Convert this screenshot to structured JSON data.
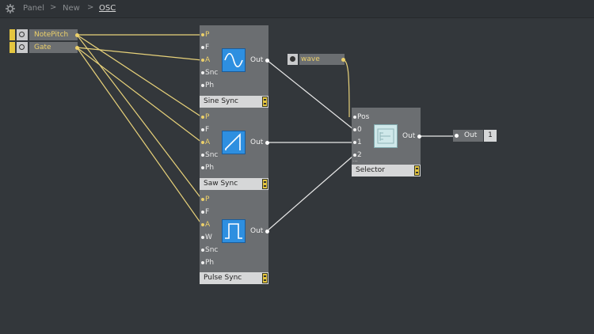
{
  "breadcrumb": {
    "items": [
      "Panel",
      "New",
      "OSC"
    ],
    "separator": ">"
  },
  "sources": [
    {
      "label": "NotePitch"
    },
    {
      "label": "Gate"
    }
  ],
  "oscillators": [
    {
      "name": "Sine Sync",
      "ports": [
        "P",
        "F",
        "A",
        "Snc",
        "Ph"
      ],
      "output": "Out",
      "waveform": "sine"
    },
    {
      "name": "Saw Sync",
      "ports": [
        "P",
        "F",
        "A",
        "Snc",
        "Ph"
      ],
      "output": "Out",
      "waveform": "saw"
    },
    {
      "name": "Pulse Sync",
      "ports": [
        "P",
        "F",
        "A",
        "W",
        "Snc",
        "Ph"
      ],
      "output": "Out",
      "waveform": "pulse"
    }
  ],
  "wave_knob": {
    "label": "wave"
  },
  "selector": {
    "name": "Selector",
    "ports": [
      "Pos",
      "0",
      "1",
      "2"
    ],
    "more": "...",
    "output": "Out"
  },
  "out_module": {
    "label": "Out",
    "channel": "1"
  },
  "colors": {
    "background": "#33373b",
    "wire_yellow": "#e8d27a",
    "wire_white": "#e8e8e8",
    "accent_blue": "#2e8fe0"
  }
}
